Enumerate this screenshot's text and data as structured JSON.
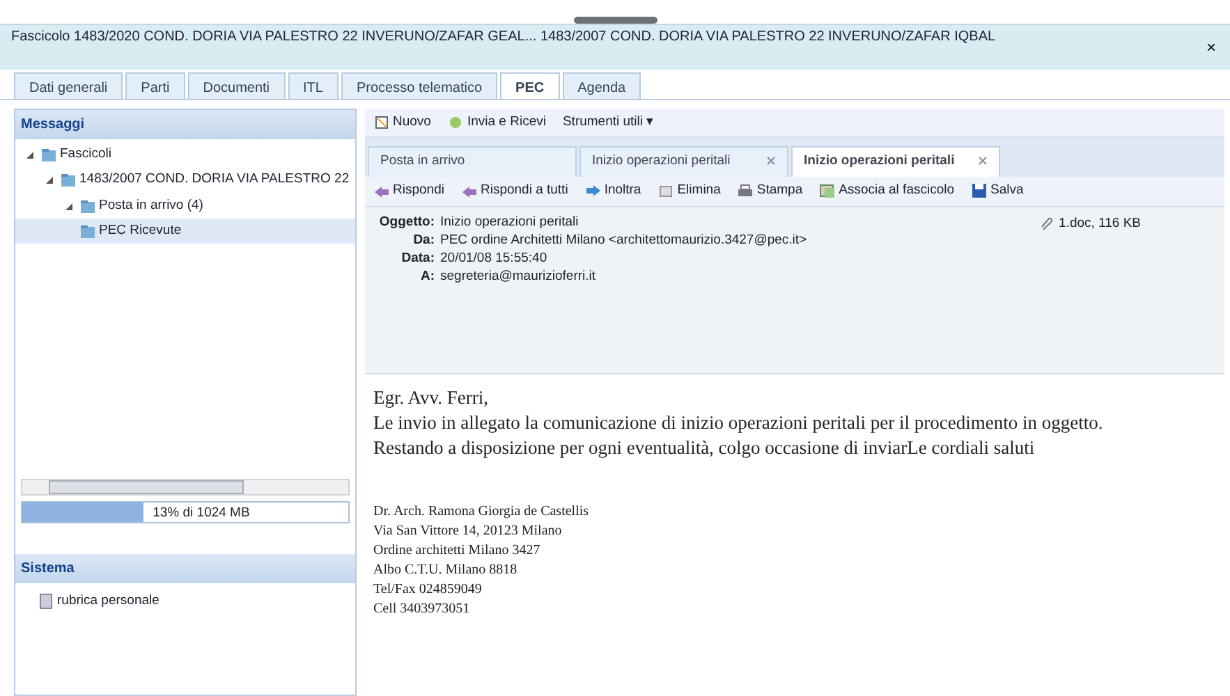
{
  "header": {
    "title": "Fascicolo 1483/2020 COND. DORIA VIA PALESTRO 22 INVERUNO/ZAFAR GEAL... 1483/2007 COND. DORIA VIA PALESTRO 22 INVERUNO/ZAFAR IQBAL",
    "close": "×"
  },
  "tabs": [
    {
      "label": "Dati generali",
      "selected": false
    },
    {
      "label": "Parti",
      "selected": false
    },
    {
      "label": "Documenti",
      "selected": false
    },
    {
      "label": "ITL",
      "selected": false
    },
    {
      "label": "Processo telematico",
      "selected": false
    },
    {
      "label": "PEC",
      "selected": true
    },
    {
      "label": "Agenda",
      "selected": false
    }
  ],
  "sidebar": {
    "title": "Messaggi",
    "tree": [
      {
        "label": "Fascicoli",
        "expanded": true,
        "selected": false,
        "children": [
          {
            "label": "1483/2007 COND. DORIA VIA PALESTRO 22",
            "expanded": true,
            "selected": false,
            "children": [
              {
                "label": "Posta in arrivo (4)",
                "expanded": true,
                "selected": false,
                "children": [
                  {
                    "label": "PEC Ricevute",
                    "selected": true
                  }
                ]
              }
            ]
          }
        ]
      }
    ],
    "quota": {
      "level": 0.37,
      "reading": "13% di 1024 MB"
    },
    "system_title": "Sistema",
    "system_items": [
      "rubrica personale"
    ]
  },
  "toolbar": [
    {
      "label": "Nuovo",
      "kind": "new"
    },
    {
      "label": "Invia e Ricevi",
      "kind": "sync"
    },
    {
      "label": "Strumenti utili ▾",
      "kind": "plain"
    }
  ],
  "message_tabs": [
    {
      "label": "Posta in arrivo",
      "closable": false,
      "selected": false
    },
    {
      "label": "Inizio operazioni peritali",
      "closable": true,
      "selected": false
    },
    {
      "label": "Inizio operazioni peritali",
      "closable": true,
      "selected": true
    }
  ],
  "actions": [
    {
      "label": "Rispondi",
      "kind": "reply"
    },
    {
      "label": "Rispondi a tutti",
      "kind": "reply"
    },
    {
      "label": "Inoltra",
      "kind": "forward"
    },
    {
      "label": "Elimina",
      "kind": "delete"
    },
    {
      "label": "Stampa",
      "kind": "print"
    },
    {
      "label": "Associa al fascicolo",
      "kind": "attach"
    },
    {
      "label": "Salva",
      "kind": "save"
    }
  ],
  "message": {
    "fields": [
      {
        "label": "Oggetto:",
        "value": "Inizio operazioni peritali"
      },
      {
        "label": "Da:",
        "value": "PEC ordine Architetti Milano <architettomaurizio.3427@pec.it>"
      },
      {
        "label": "Data:",
        "value": "20/01/08 15:55:40"
      },
      {
        "label": "A:",
        "value": "segreteria@maurizioferri.it"
      }
    ],
    "attachment": "1.doc, 116 KB",
    "body": [
      "Egr. Avv. Ferri,",
      "Le invio in allegato la comunicazione di inizio operazioni peritali per il procedimento in oggetto.",
      "Restando a disposizione per ogni eventualità, colgo occasione di inviarLe cordiali saluti"
    ],
    "signature": [
      "Dr. Arch. Ramona Giorgia de Castellis",
      "Via San Vittore 14, 20123 Milano",
      "Ordine architetti Milano 3427",
      "Albo C.T.U. Milano 8818",
      "Tel/Fax 024859049",
      "Cell 3403973051"
    ]
  }
}
